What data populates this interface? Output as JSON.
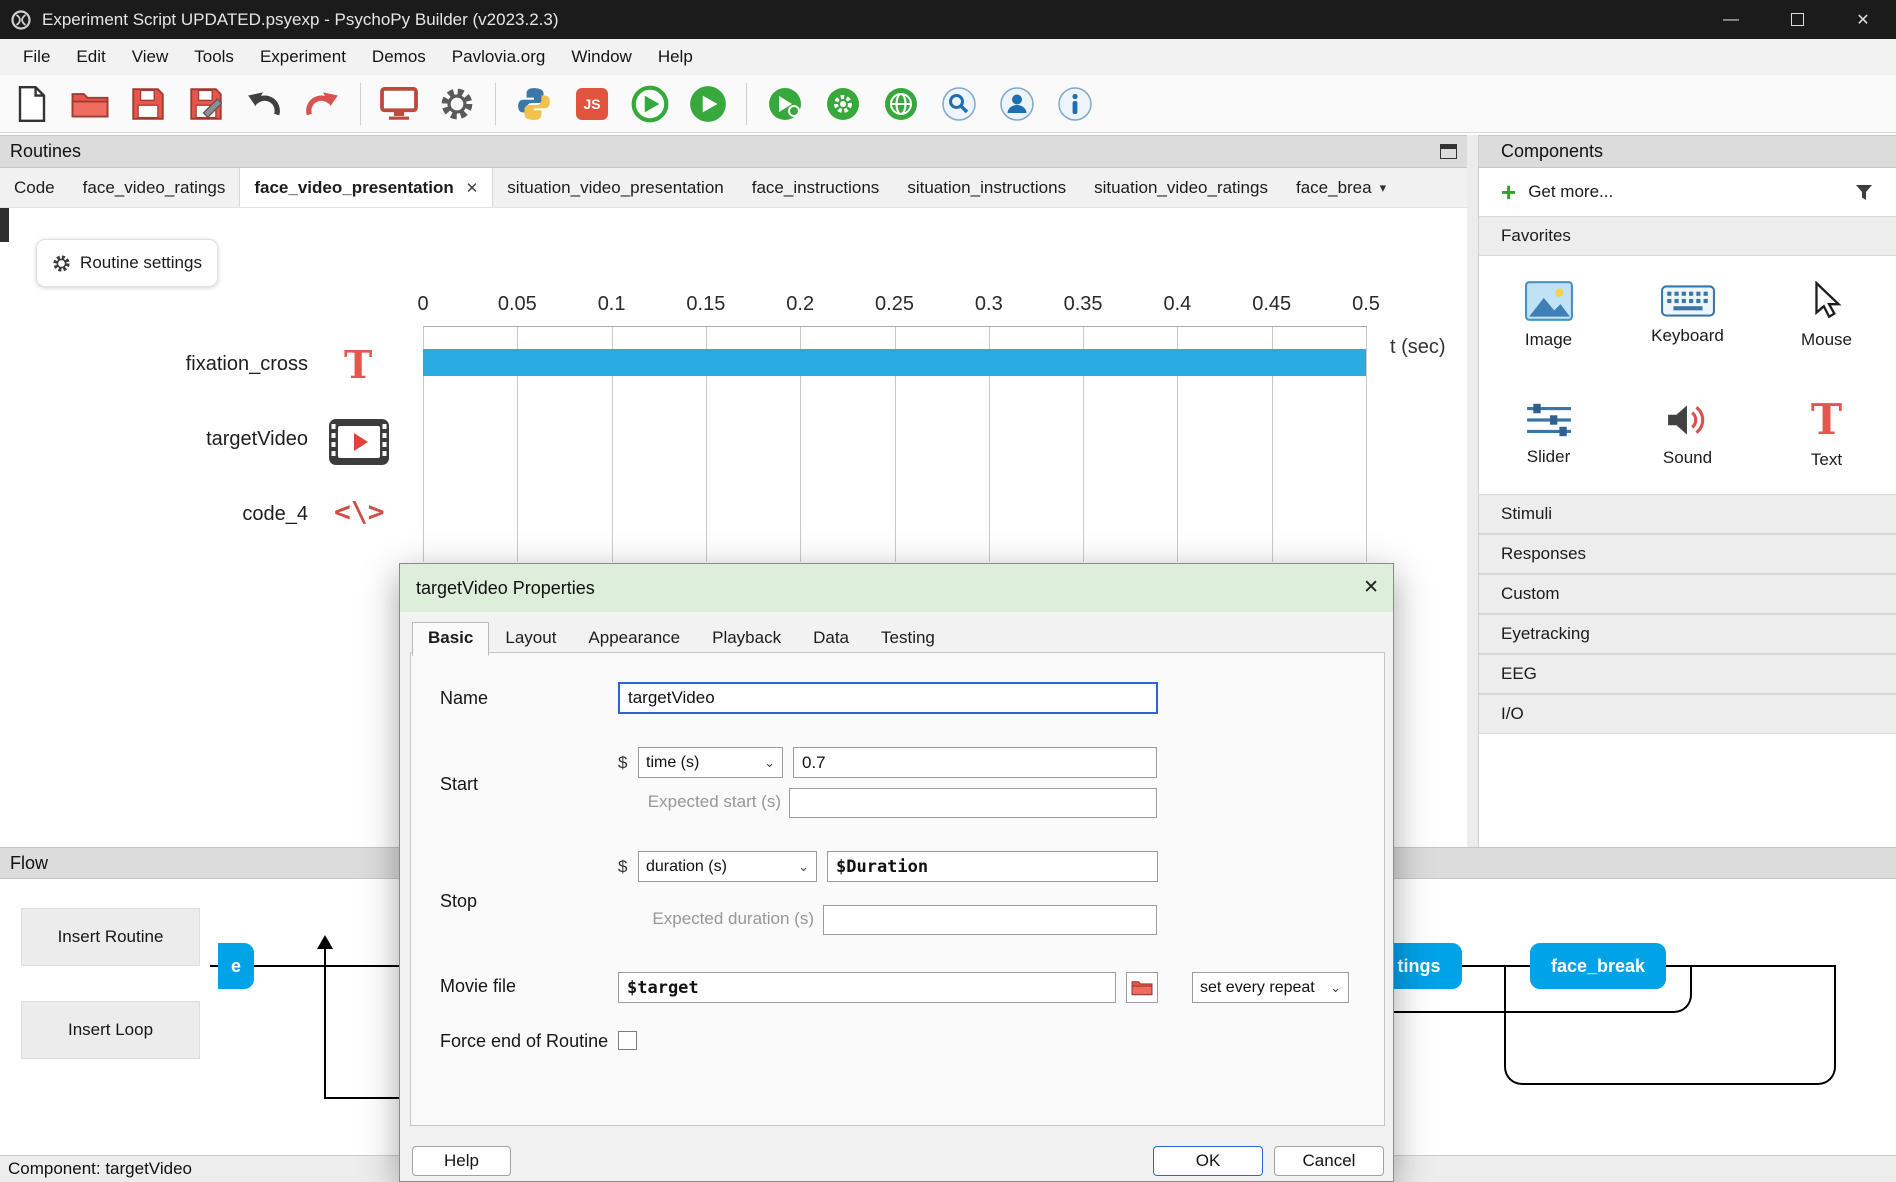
{
  "icons": {
    "close": "✕",
    "minimize": "—",
    "chevron_down": "⌄",
    "overflow_down": "▾",
    "dollar": "$",
    "text_glyph": "T",
    "code_glyph": "<\\>",
    "plus": "+",
    "js_label": "JS"
  },
  "window": {
    "title": "Experiment Script UPDATED.psyexp - PsychoPy Builder (v2023.2.3)"
  },
  "menu": [
    "File",
    "Edit",
    "View",
    "Tools",
    "Experiment",
    "Demos",
    "Pavlovia.org",
    "Window",
    "Help"
  ],
  "routines": {
    "title": "Routines",
    "tabs": [
      "Code",
      "face_video_ratings",
      "face_video_presentation",
      "situation_video_presentation",
      "face_instructions",
      "situation_instructions",
      "situation_video_ratings",
      "face_brea"
    ],
    "settings_button": "Routine settings",
    "timeline": {
      "ticks": [
        "0",
        "0.05",
        "0.1",
        "0.15",
        "0.2",
        "0.25",
        "0.3",
        "0.35",
        "0.4",
        "0.45",
        "0.5"
      ],
      "axis_label": "t (sec)",
      "rows": [
        "fixation_cross",
        "targetVideo",
        "code_4"
      ]
    }
  },
  "components": {
    "title": "Components",
    "get_more": "Get more...",
    "favorites_header": "Favorites",
    "favorites": [
      "Image",
      "Keyboard",
      "Mouse",
      "Slider",
      "Sound",
      "Text"
    ],
    "sections": [
      "Stimuli",
      "Responses",
      "Custom",
      "Eyetracking",
      "EEG",
      "I/O"
    ]
  },
  "dialog": {
    "title": "targetVideo Properties",
    "tabs": [
      "Basic",
      "Layout",
      "Appearance",
      "Playback",
      "Data",
      "Testing"
    ],
    "name_label": "Name",
    "name_value": "targetVideo",
    "start_label": "Start",
    "start_type": "time (s)",
    "start_value": "0.7",
    "expected_start_label": "Expected start (s)",
    "expected_start_value": "",
    "stop_label": "Stop",
    "stop_type": "duration (s)",
    "stop_value": "$Duration",
    "expected_duration_label": "Expected duration (s)",
    "expected_duration_value": "",
    "movie_label": "Movie file",
    "movie_value": "$target",
    "movie_update": "set every repeat",
    "force_end_label": "Force end of Routine",
    "help": "Help",
    "ok": "OK",
    "cancel": "Cancel"
  },
  "flow": {
    "title": "Flow",
    "insert_routine": "Insert Routine",
    "insert_loop": "Insert Loop",
    "nodes": [
      "e",
      "tings",
      "face_break"
    ],
    "status": "Component: targetVideo"
  },
  "colors": {
    "timeline_bar": "#29abe2",
    "flow_node": "#00a2e8",
    "dialog_titlebar": "#ddeeda",
    "accent_red": "#e4574e",
    "run_green": "#37a93c"
  }
}
